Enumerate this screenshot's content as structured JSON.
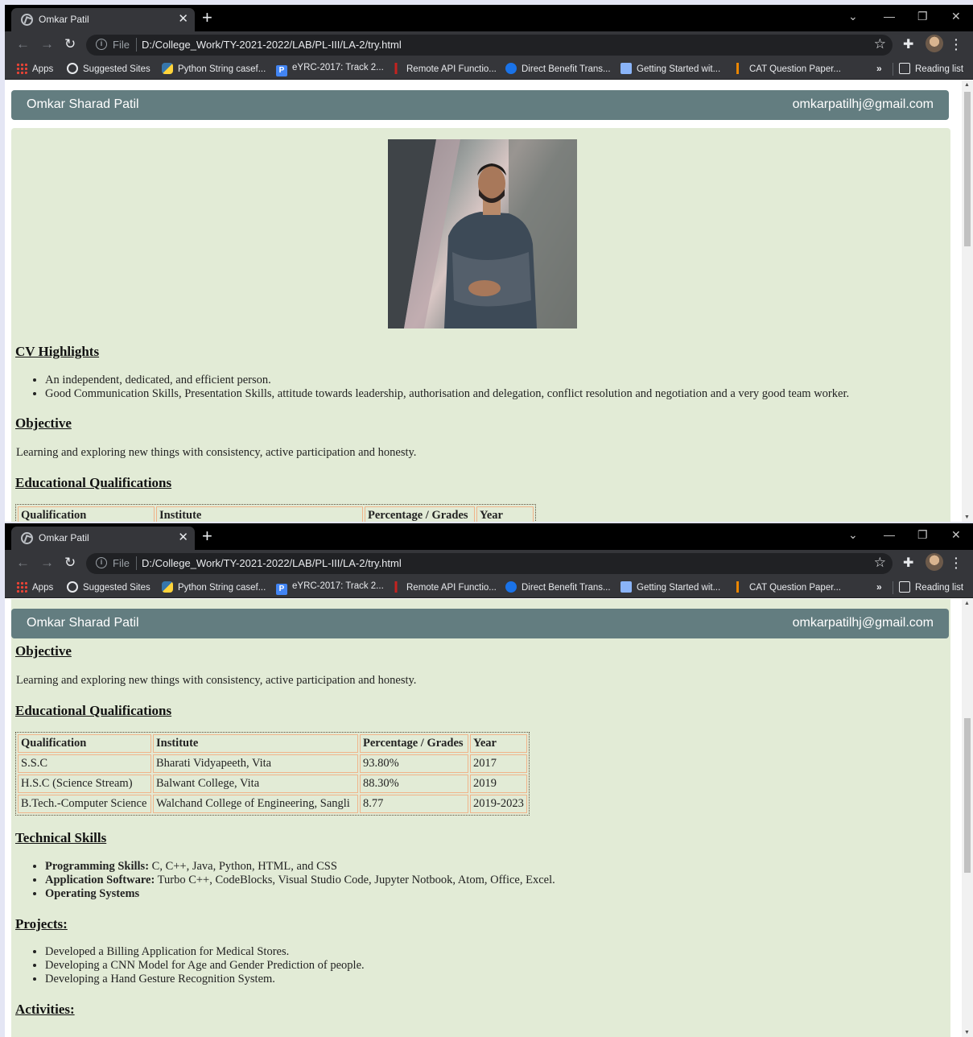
{
  "browser": {
    "tab_title": "Omkar Patil",
    "file_label": "File",
    "url": "D:/College_Work/TY-2021-2022/LAB/PL-III/LA-2/try.html",
    "bookmarks": [
      {
        "label": "Apps",
        "icon": "apps-grid-icon"
      },
      {
        "label": "Suggested Sites",
        "icon": "globe-icon"
      },
      {
        "label": "Python String casef...",
        "icon": "python-icon"
      },
      {
        "label": "eYRC-2017: Track 2...",
        "icon": "p-icon"
      },
      {
        "label": "Remote API Functio...",
        "icon": "feather-icon"
      },
      {
        "label": "Direct Benefit Trans...",
        "icon": "gov-icon"
      },
      {
        "label": "Getting Started wit...",
        "icon": "doc-icon"
      },
      {
        "label": "CAT Question Paper...",
        "icon": "cat-icon"
      }
    ],
    "more_bookmarks": "»",
    "reading_list": "Reading list"
  },
  "header": {
    "name": "Omkar Sharad Patil",
    "email": "omkarpatilhj@gmail.com"
  },
  "cv": {
    "highlights_title": "CV Highlights",
    "highlights": [
      "An independent, dedicated, and efficient person.",
      "Good Communication Skills, Presentation Skills, attitude towards leadership, authorisation and delegation, conflict resolution and negotiation and a very good team worker."
    ],
    "objective_title": "Objective",
    "objective_text": "Learning and exploring new things with consistency, active participation and honesty.",
    "education_title": "Educational Qualifications",
    "education_headers": [
      "Qualification",
      "Institute",
      "Percentage / Grades",
      "Year"
    ],
    "education_rows": [
      [
        "S.S.C",
        "Bharati Vidyapeeth, Vita",
        "93.80%",
        "2017"
      ],
      [
        "H.S.C (Science Stream)",
        "Balwant College, Vita",
        "88.30%",
        "2019"
      ],
      [
        "B.Tech.-Computer Science",
        "Walchand College of Engineering, Sangli",
        "8.77",
        "2019-2023"
      ]
    ],
    "skills_title": "Technical Skills",
    "skills": [
      {
        "label": "Programming Skills:",
        "value": " C, C++, Java, Python, HTML, and CSS"
      },
      {
        "label": "Application Software:",
        "value": " Turbo C++, CodeBlocks, Visual Studio Code, Jupyter Notbook, Atom, Office, Excel."
      },
      {
        "label": "Operating Systems",
        "value": ""
      }
    ],
    "projects_title": "Projects:",
    "projects": [
      "Developed a Billing Application for Medical Stores.",
      "Developing a CNN Model for Age and Gender Prediction of people.",
      "Developing a Hand Gesture Recognition System."
    ],
    "activities_title": "Activities:"
  },
  "colors": {
    "header_bg": "#637d80",
    "content_bg": "#e2ebd6",
    "table_border": "#f0b48a"
  }
}
